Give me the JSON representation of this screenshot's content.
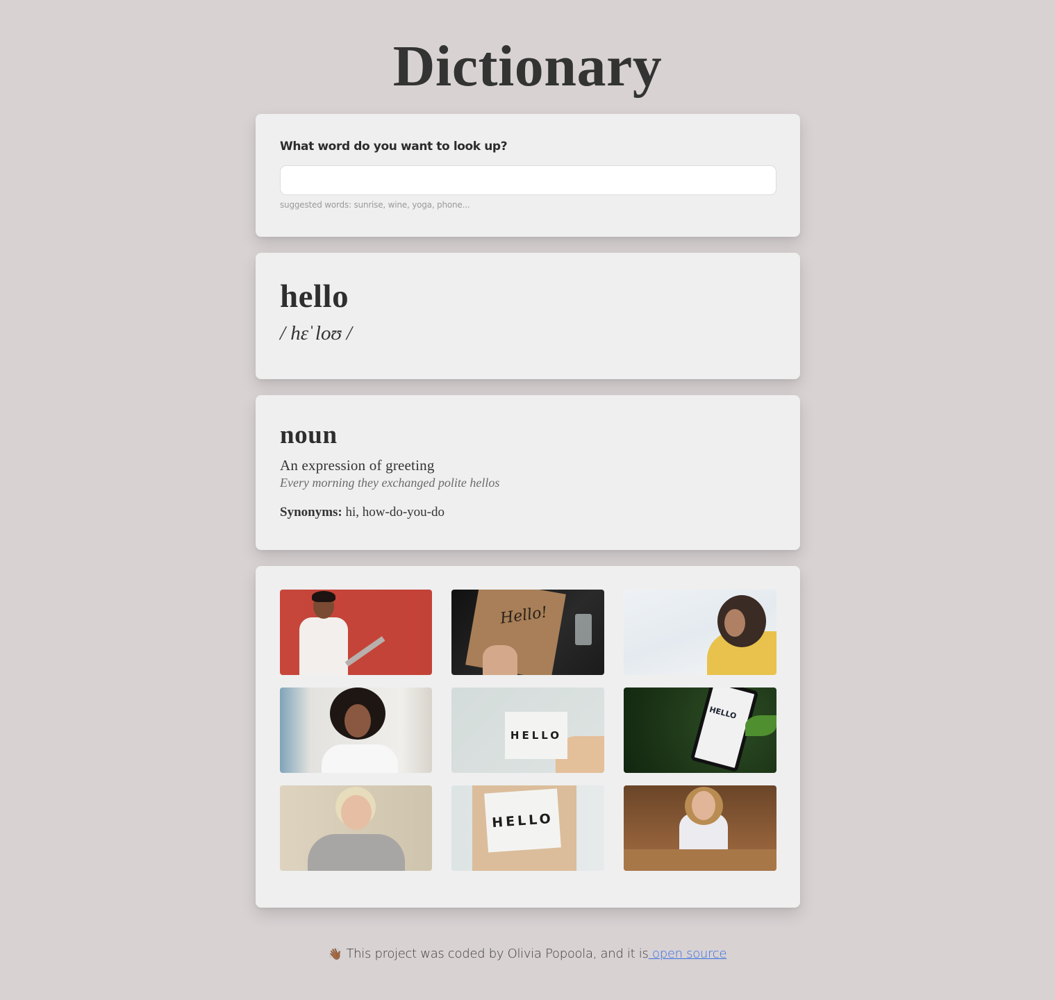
{
  "header": {
    "title": "Dictionary"
  },
  "search": {
    "label": "What word do you want to look up?",
    "value": "",
    "placeholder": "",
    "hint": "suggested words: sunrise, wine, yoga, phone..."
  },
  "result": {
    "word": "hello",
    "phonetic": "/ hɛˈloʊ /"
  },
  "meanings": [
    {
      "part_of_speech": "noun",
      "definition": "An expression of greeting",
      "example": "Every morning they exchanged polite hellos",
      "synonyms_label": "Synonyms:",
      "synonyms": "hi, how-do-you-do"
    }
  ],
  "photos": [
    {
      "alt": "man waving at laptop against red wall"
    },
    {
      "alt": "hand lettering Hello on kraft paper"
    },
    {
      "alt": "woman in yellow waving against sky"
    },
    {
      "alt": "child waving in bright room"
    },
    {
      "alt": "HELLO lightbox sign held in hand",
      "sign_text": "HELLO"
    },
    {
      "alt": "phone showing HELLO among green leaves",
      "sign_text": "HELLO"
    },
    {
      "alt": "person with headphones waving"
    },
    {
      "alt": "person holding HELLO lightbox",
      "sign_text": "HELLO"
    },
    {
      "alt": "woman waving at laptop in cafe"
    }
  ],
  "footer": {
    "emoji": "👋🏾",
    "text": "This project was coded by Olivia Popoola, and it is",
    "link_text": " open source",
    "link_color": "#3b6fe0"
  }
}
